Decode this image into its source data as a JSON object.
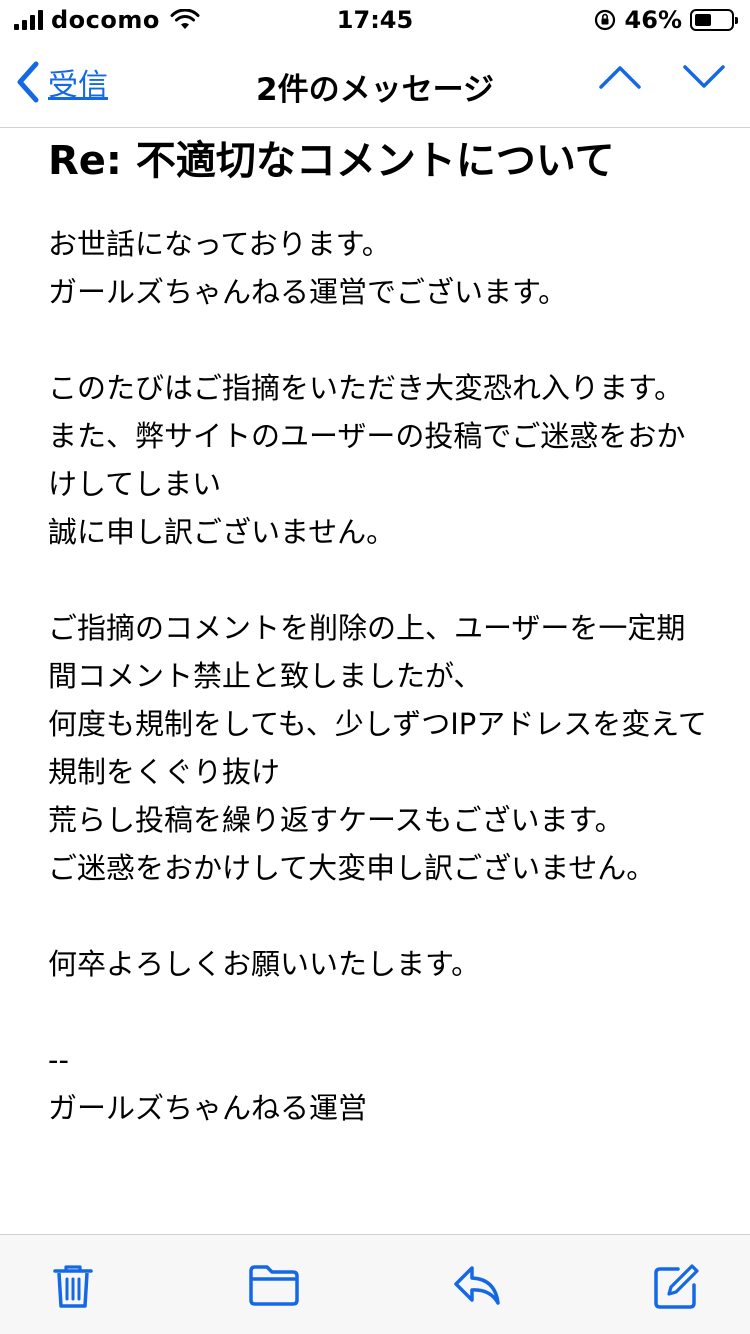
{
  "status_bar": {
    "carrier": "docomo",
    "time": "17:45",
    "battery_percent": "46%",
    "battery_level": 0.46
  },
  "nav": {
    "back_label": "受信",
    "title": "2件のメッセージ",
    "accent_color": "#1468e6"
  },
  "message": {
    "subject": "Re: 不適切なコメントについて",
    "body": "お世話になっております。\nガールズちゃんねる運営でございます。\n\nこのたびはご指摘をいただき大変恐れ入ります。\nまた、弊サイトのユーザーの投稿でご迷惑をおかけしてしまい\n誠に申し訳ございません。\n\nご指摘のコメントを削除の上、ユーザーを一定期間コメント禁止と致しましたが、\n何度も規制をしても、少しずつIPアドレスを変えて規制をくぐり抜け\n荒らし投稿を繰り返すケースもございます。\nご迷惑をおかけして大変申し訳ございません。\n\n何卒よろしくお願いいたします。\n\n--\nガールズちゃんねる運営"
  },
  "toolbar": {
    "icons": [
      "trash-icon",
      "folder-icon",
      "reply-icon",
      "compose-icon"
    ]
  }
}
